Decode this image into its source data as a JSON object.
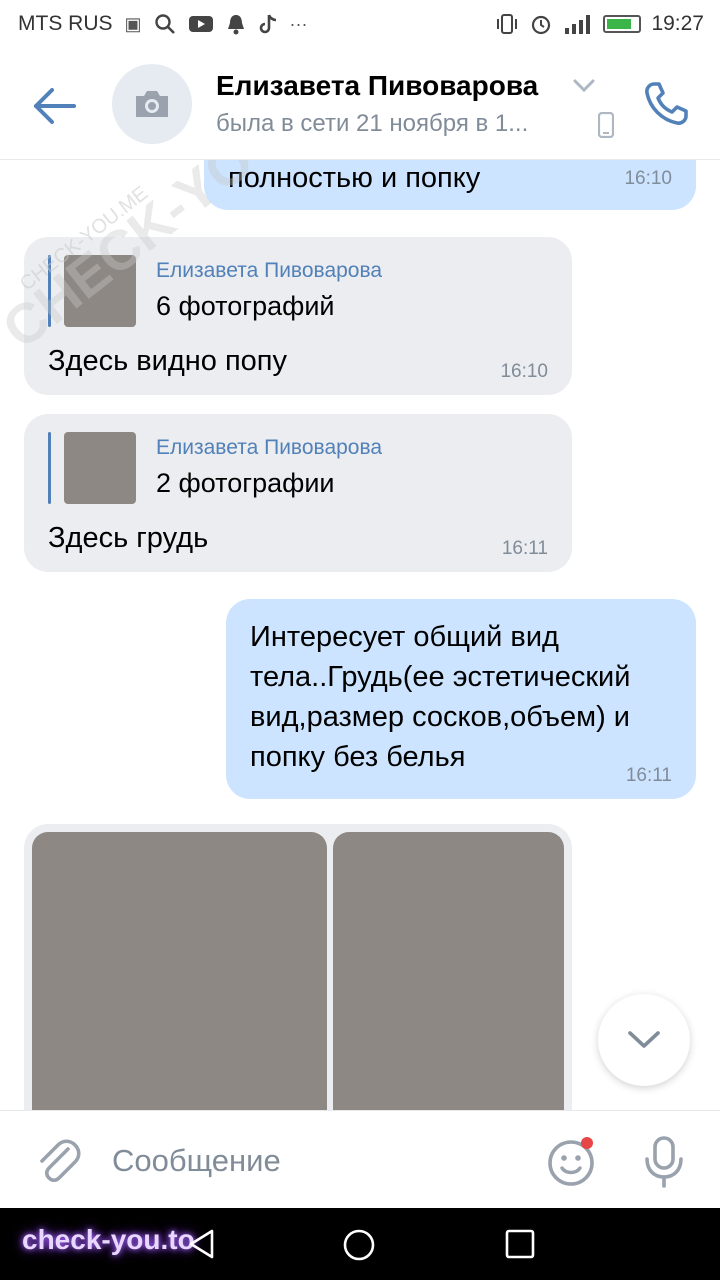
{
  "status_bar": {
    "carrier": "MTS RUS",
    "time": "19:27",
    "battery_level": 0.8,
    "icons": [
      "sim-icon",
      "search-icon",
      "youtube-icon",
      "notification-icon",
      "tiktok-icon",
      "more-icon",
      "vibrate-icon",
      "alarm-icon",
      "signal-icon",
      "battery-icon"
    ]
  },
  "header": {
    "name": "Елизавета Пивоварова",
    "status": "была в сети 21 ноября в 1..."
  },
  "messages": [
    {
      "direction": "out",
      "text": "полностью и попку",
      "time": "16:10"
    },
    {
      "direction": "in",
      "forward": {
        "author": "Елизавета Пивоварова",
        "count": "6 фотографий"
      },
      "text": "Здесь видно попу",
      "time": "16:10"
    },
    {
      "direction": "in",
      "forward": {
        "author": "Елизавета Пивоварова",
        "count": "2 фотографии"
      },
      "text": "Здесь грудь",
      "time": "16:11"
    },
    {
      "direction": "out",
      "lines": [
        "Интересует общий вид",
        "тела..Грудь(ее эстетический",
        "вид,размер сосков,объем) и",
        "попку без белья"
      ],
      "time": "16:11"
    },
    {
      "direction": "in",
      "photos": 2
    }
  ],
  "input": {
    "placeholder": "Сообщение"
  },
  "watermarks": {
    "diagonal": "CHECK-YOU.ME",
    "small": "CHECK-YOU.ME",
    "bottom": "check-you.to"
  },
  "colors": {
    "accent": "#5181b8",
    "outgoing_bubble": "#cce4ff",
    "incoming_bubble": "#ebedf0",
    "secondary_text": "#818c99",
    "unread_dot": "#e64646"
  }
}
